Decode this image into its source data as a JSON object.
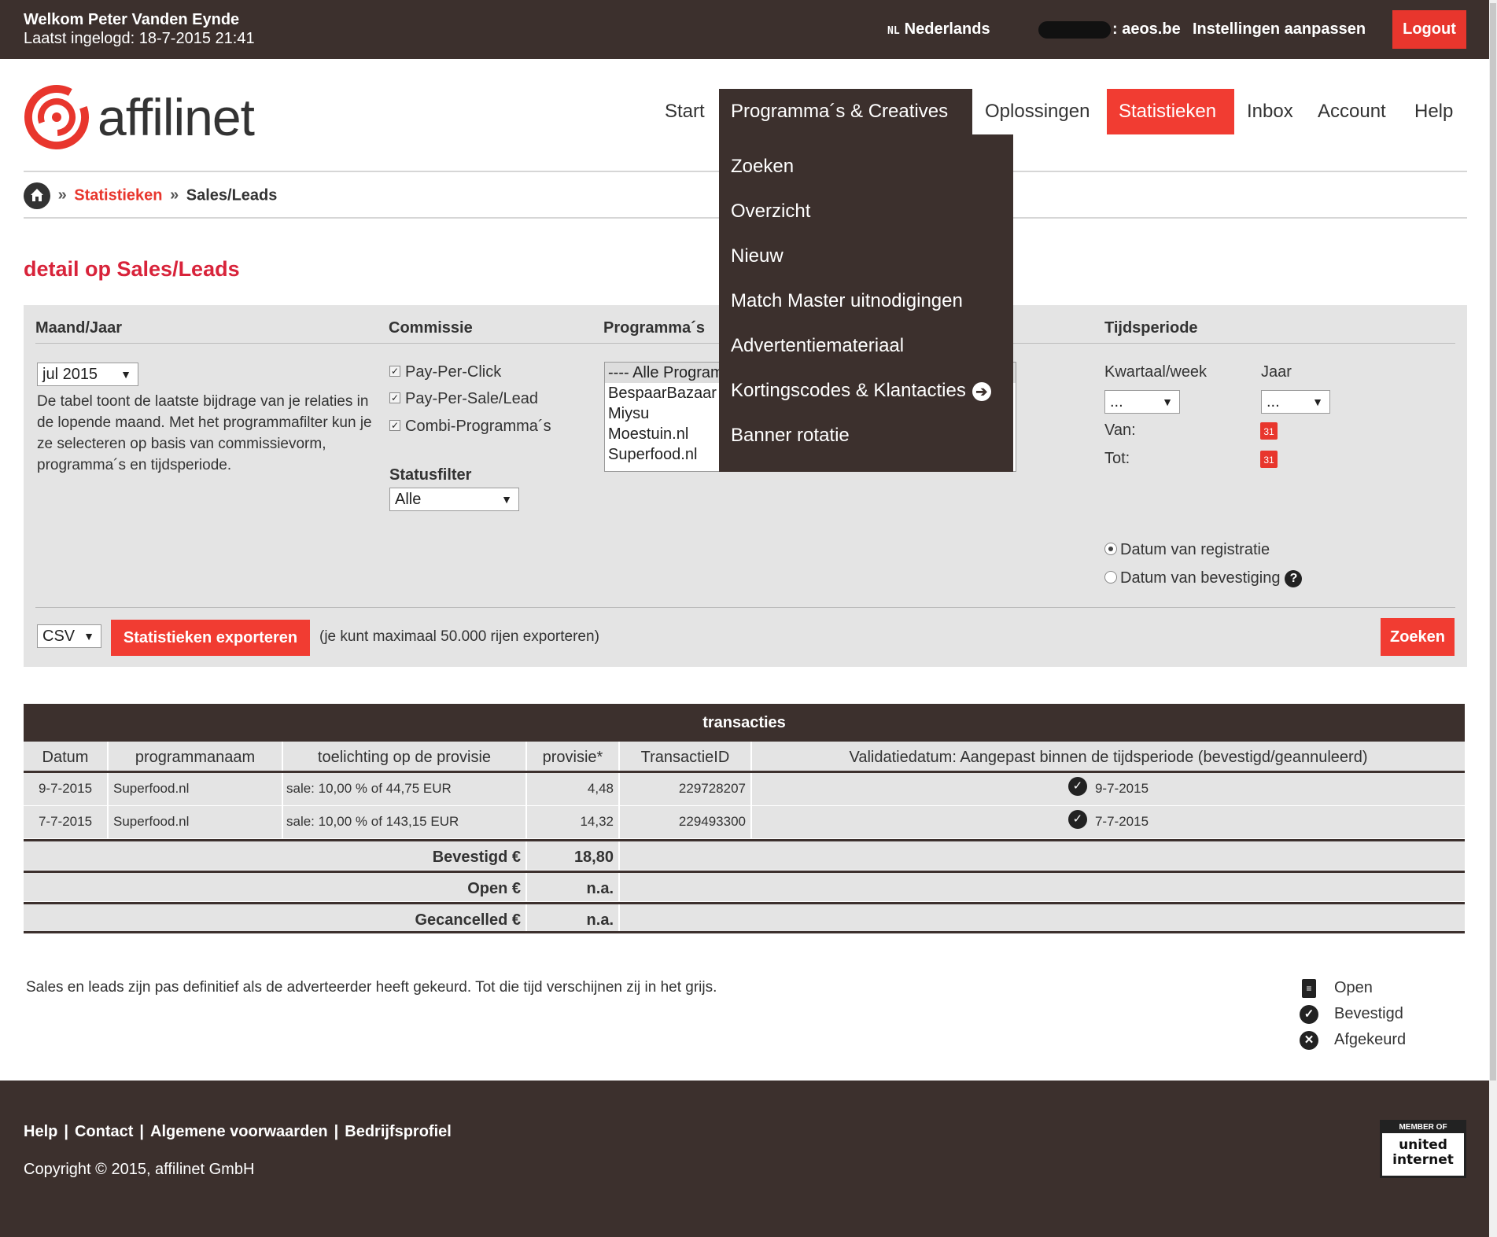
{
  "topbar": {
    "welcome": "Welkom Peter Vanden Eynde",
    "last_login": "Laatst ingelogd: 18-7-2015 21:41",
    "lang_flag": "NL",
    "language": "Nederlands",
    "account_suffix": ": aeos.be",
    "settings": "Instellingen aanpassen",
    "logout": "Logout"
  },
  "logo": {
    "text": "affilinet",
    "color": "#e8362d"
  },
  "nav": {
    "items": [
      {
        "label": "Start"
      },
      {
        "label": "Programma´s & Creatives"
      },
      {
        "label": "Oplossingen"
      },
      {
        "label": "Statistieken"
      },
      {
        "label": "Inbox"
      },
      {
        "label": "Account"
      },
      {
        "label": "Help"
      }
    ]
  },
  "dropdown": {
    "items": [
      "Zoeken",
      "Overzicht",
      "Nieuw",
      "Match Master uitnodigingen",
      "Advertentiemateriaal",
      "Kortingscodes & Klantacties",
      "Banner rotatie"
    ]
  },
  "breadcrumb": {
    "sep": "»",
    "section": "Statistieken",
    "current": "Sales/Leads"
  },
  "page_title": "detail op Sales/Leads",
  "filter": {
    "headings": {
      "month": "Maand/Jaar",
      "commission": "Commissie",
      "programs": "Programma´s",
      "period": "Tijdsperiode"
    },
    "month_value": "jul 2015",
    "description": "De tabel toont de laatste bijdrage van je relaties in de lopende maand. Met het programmafilter kun je ze selecteren op basis van commissievorm, programma´s en tijdsperiode.",
    "commission_options": [
      "Pay-Per-Click",
      "Pay-Per-Sale/Lead",
      "Combi-Programma´s"
    ],
    "status_label": "Statusfilter",
    "status_value": "Alle",
    "program_options": [
      "---- Alle Programma´s ----",
      "BespaarBazaar",
      "Miysu",
      "Moestuin.nl",
      "Superfood.nl"
    ],
    "quarter_label": "Kwartaal/week",
    "quarter_value": "...",
    "year_label": "Jaar",
    "year_value": "...",
    "from_label": "Van:",
    "to_label": "Tot:",
    "calendar_day": "31",
    "date_options": [
      "Datum van registratie",
      "Datum van bevestiging"
    ],
    "help_glyph": "?",
    "export_format": "CSV",
    "export_button": "Statistieken exporteren",
    "export_note": "(je kunt maximaal 50.000 rijen exporteren)",
    "search_button": "Zoeken"
  },
  "transactions": {
    "title": "transacties",
    "columns": [
      "Datum",
      "programmanaam",
      "toelichting op de provisie",
      "provisie*",
      "TransactieID",
      "Validatiedatum: Aangepast binnen de tijdsperiode (bevestigd/geannuleerd)"
    ],
    "rows": [
      {
        "date": "9-7-2015",
        "program": "Superfood.nl",
        "note": "sale: 10,00 % of 44,75 EUR",
        "commission": "4,48",
        "id": "229728207",
        "validated": "9-7-2015"
      },
      {
        "date": "7-7-2015",
        "program": "Superfood.nl",
        "note": "sale: 10,00 % of 143,15 EUR",
        "commission": "14,32",
        "id": "229493300",
        "validated": "7-7-2015"
      }
    ],
    "totals": [
      {
        "label": "Bevestigd €",
        "value": "18,80"
      },
      {
        "label": "Open €",
        "value": "n.a."
      },
      {
        "label": "Gecancelled €",
        "value": "n.a."
      }
    ]
  },
  "note": "Sales en leads zijn pas definitief als de adverteerder heeft gekeurd. Tot die tijd verschijnen zij in het grijs.",
  "legend": [
    "Open",
    "Bevestigd",
    "Afgekeurd"
  ],
  "footer": {
    "links": [
      "Help",
      "Contact",
      "Algemene voorwaarden",
      "Bedrijfsprofiel"
    ],
    "copyright": "Copyright © 2015, affilinet GmbH",
    "badge_top": "MEMBER OF",
    "badge_line1": "united",
    "badge_line2": "internet"
  }
}
